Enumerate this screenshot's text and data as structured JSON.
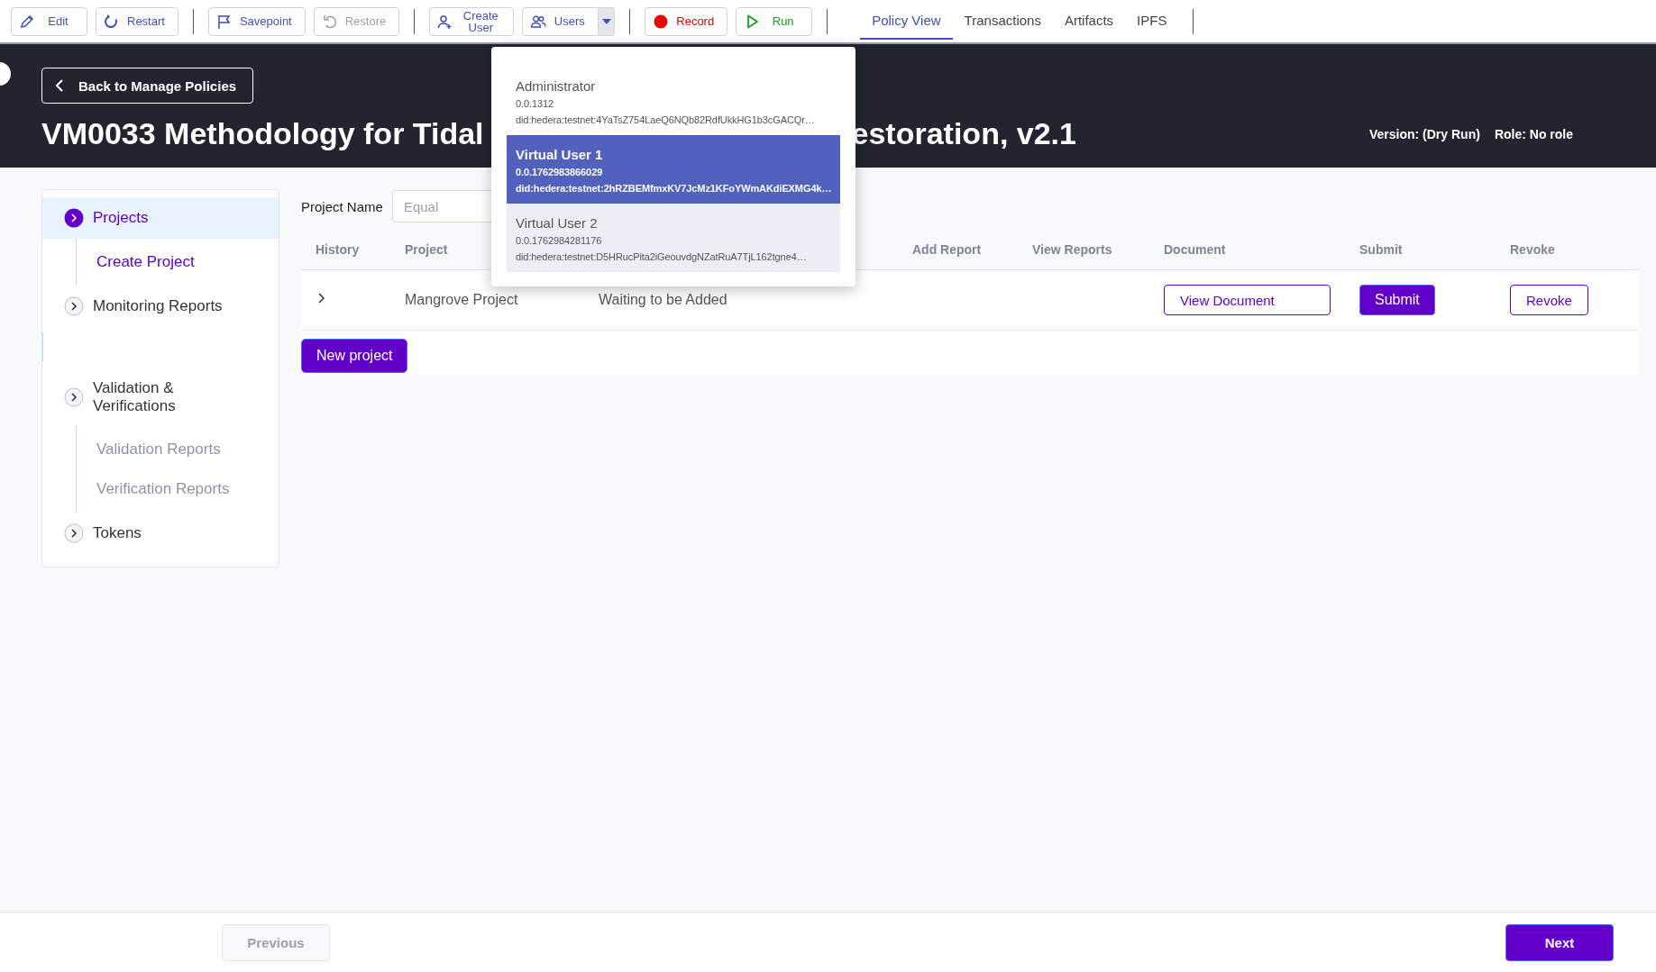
{
  "toolbar": {
    "groups": [
      {
        "buttons": [
          {
            "kind": "edit",
            "label": "Edit",
            "disabled": false
          },
          {
            "kind": "restart",
            "label": "Restart",
            "disabled": false
          }
        ]
      },
      {
        "buttons": [
          {
            "kind": "savepoint",
            "label": "Savepoint",
            "disabled": false
          },
          {
            "kind": "restore",
            "label": "Restore",
            "disabled": true
          }
        ]
      },
      {
        "buttons": [
          {
            "kind": "create-user",
            "label": "Create User",
            "disabled": false
          },
          {
            "kind": "users",
            "label": "Users",
            "disabled": false
          }
        ]
      },
      {
        "buttons": [
          {
            "kind": "record",
            "label": "Record",
            "disabled": false
          },
          {
            "kind": "run",
            "label": "Run",
            "disabled": false
          }
        ]
      }
    ]
  },
  "tabs": [
    {
      "label": "Policy View",
      "selected": true
    },
    {
      "label": "Transactions",
      "selected": false
    },
    {
      "label": "Artifacts",
      "selected": false
    },
    {
      "label": "IPFS",
      "selected": false
    }
  ],
  "header": {
    "back_button": "Back to Manage Policies",
    "title_parts": [
      "VM0033 Methodology for Tidal",
      "estoration, v2.1"
    ],
    "version": "Version: (Dry Run)",
    "role": "Role: No role"
  },
  "sidebar": {
    "items": [
      {
        "label": "Projects",
        "selected": true,
        "children": [
          {
            "label": "Create Project",
            "selected": true
          }
        ]
      },
      {
        "label": "Monitoring Reports",
        "selected": false
      },
      {
        "label": "Validation & Verifications",
        "selected": false,
        "children": [
          {
            "label": "Validation Reports",
            "selected": false
          },
          {
            "label": "Verification Reports",
            "selected": false
          }
        ]
      },
      {
        "label": "Tokens",
        "selected": false
      }
    ]
  },
  "filter": {
    "label": "Project Name",
    "placeholder": "Equal"
  },
  "table": {
    "columns": [
      {
        "label": "History"
      },
      {
        "label": "Project"
      },
      {
        "obscured": true
      },
      {
        "label": "Add Report"
      },
      {
        "label": "View Reports"
      },
      {
        "label": "Document"
      },
      {
        "label": "Submit"
      },
      {
        "label": "Revoke"
      }
    ],
    "rows": [
      {
        "cells": [
          {
            "kind": "expander"
          },
          {
            "kind": "text",
            "text": "Mangrove Project"
          },
          {
            "kind": "text",
            "text": "Waiting to be Added"
          },
          {
            "kind": "empty"
          },
          {
            "kind": "empty"
          },
          {
            "kind": "outline-button",
            "text": "View Document"
          },
          {
            "kind": "filled-button",
            "text": "Submit"
          },
          {
            "kind": "outline-button",
            "text": "Revoke"
          }
        ]
      }
    ]
  },
  "new_project_button": "New project",
  "users_menu": {
    "items": [
      {
        "name": "Administrator",
        "account": "0.0.1312",
        "did": "did:hedera:testnet:4YaTsZ754LaeQ6NQb82RdfUkkHG1b3cGACQr…",
        "selected": false,
        "hovered": false
      },
      {
        "name": "Virtual User 1",
        "account": "0.0.1762983866029",
        "did": "did:hedera:testnet:2hRZBEMfmxKV7JcMz1KFoYWmAKdiEXMG4k…",
        "selected": true,
        "hovered": false
      },
      {
        "name": "Virtual User 2",
        "account": "0.0.1762984281176",
        "did": "did:hedera:testnet:D5HRucPita2iGeouvdgNZatRuA7TjL162tgne4…",
        "selected": false,
        "hovered": true
      }
    ]
  },
  "footer": {
    "previous": {
      "label": "Previous",
      "disabled": true
    },
    "next": {
      "label": "Next",
      "disabled": false
    }
  }
}
